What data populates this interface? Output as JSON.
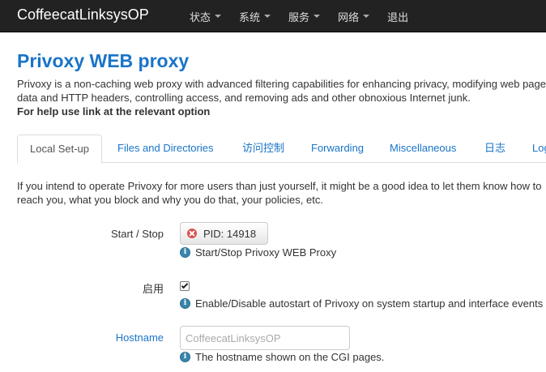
{
  "navbar": {
    "brand": "CoffeecatLinksysOP",
    "menu": [
      {
        "label": "状态"
      },
      {
        "label": "系统"
      },
      {
        "label": "服务"
      },
      {
        "label": "网络"
      },
      {
        "label": "退出"
      }
    ]
  },
  "page": {
    "title": "Privoxy WEB proxy",
    "description": "Privoxy is a non-caching web proxy with advanced filtering capabilities for enhancing privacy, modifying web page data and HTTP headers, controlling access, and removing ads and other obnoxious Internet junk.",
    "help_text": "For help use link at the relevant option"
  },
  "tabs": [
    {
      "label": "Local Set-up",
      "active": true
    },
    {
      "label": "Files and Directories"
    },
    {
      "label": "访问控制"
    },
    {
      "label": "Forwarding"
    },
    {
      "label": "Miscellaneous"
    },
    {
      "label": "日志"
    },
    {
      "label": "Log"
    }
  ],
  "section": {
    "intro": "If you intend to operate Privoxy for more users than just yourself, it might be a good idea to let them know how to reach you, what you block and why you do that, your policies, etc."
  },
  "fields": {
    "start_stop": {
      "label": "Start / Stop",
      "button_label": "PID: 14918",
      "hint": "Start/Stop Privoxy WEB Proxy"
    },
    "enable": {
      "label": "启用",
      "checked": true,
      "hint": "Enable/Disable autostart of Privoxy on system startup and interface events"
    },
    "hostname": {
      "label": "Hostname",
      "value": "",
      "placeholder": "CoffeecatLinksysOP",
      "hint": "The hostname shown on the CGI pages."
    }
  },
  "colors": {
    "navbar_bg": "#222222",
    "link": "#1a74c8",
    "info_icon": "#3a87ad",
    "stop_icon": "#d9534f"
  },
  "icons": {
    "caret": "chevron-down-icon",
    "stop": "stop-icon",
    "info": "info-icon"
  }
}
